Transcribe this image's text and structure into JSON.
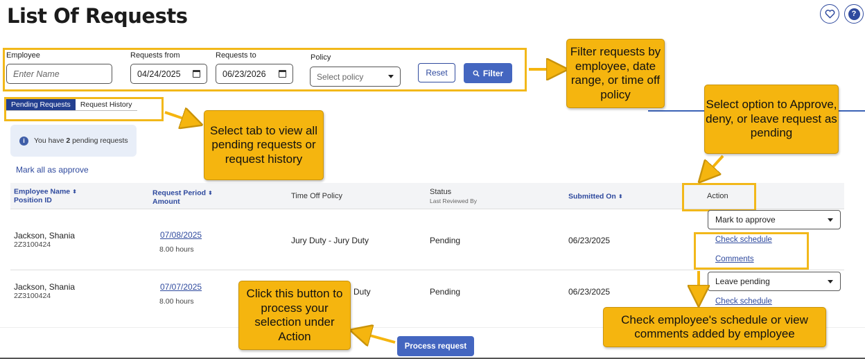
{
  "page": {
    "title": "List Of Requests"
  },
  "header_icons": [
    "heart-icon",
    "help-icon"
  ],
  "filters": {
    "employee_label": "Employee",
    "employee_placeholder": "Enter Name",
    "from_label": "Requests from",
    "from_value": "04/24/2025",
    "to_label": "Requests to",
    "to_value": "06/23/2026",
    "policy_label": "Policy",
    "policy_placeholder": "Select policy",
    "reset_label": "Reset",
    "filter_label": "Filter"
  },
  "tabs": [
    {
      "label": "Pending Requests",
      "active": true
    },
    {
      "label": "Request History",
      "active": false
    }
  ],
  "info": {
    "prefix": "You have",
    "count": "2",
    "suffix": "pending requests"
  },
  "mark_all_label": "Mark all as approve",
  "table": {
    "headers": {
      "employee": "Employee Name",
      "employee_sub": "Position ID",
      "period": "Request Period",
      "period_sub": "Amount",
      "policy": "Time Off Policy",
      "status": "Status",
      "status_sub": "Last Reviewed By",
      "submitted": "Submitted On",
      "action": "Action"
    },
    "rows": [
      {
        "name": "Jackson, Shania",
        "position_id": "2Z3100424",
        "date": "07/08/2025",
        "hours": "8.00 hours",
        "policy": "Jury Duty - Jury Duty",
        "status": "Pending",
        "submitted": "06/23/2025",
        "action": "Mark to approve",
        "links": [
          "Check schedule",
          "Comments"
        ]
      },
      {
        "name": "Jackson, Shania",
        "position_id": "2Z3100424",
        "date": "07/07/2025",
        "hours": "8.00 hours",
        "policy": "Duty",
        "status": "Pending",
        "submitted": "06/23/2025",
        "action": "Leave pending",
        "links": [
          "Check schedule"
        ]
      }
    ]
  },
  "process_label": "Process request",
  "callouts": {
    "filter": "Filter requests by employee, date range, or time off policy",
    "tabs": "Select tab to view all pending requests or request history",
    "action": "Select option to Approve, deny, or leave request as pending",
    "process": "Click this button to process your selection under Action",
    "schedule": "Check employee's schedule or view comments added by employee"
  },
  "colors": {
    "accent": "#2f4a9e",
    "button": "#4466c0",
    "callout": "#f5b50f",
    "highlight": "#f2b81a"
  }
}
